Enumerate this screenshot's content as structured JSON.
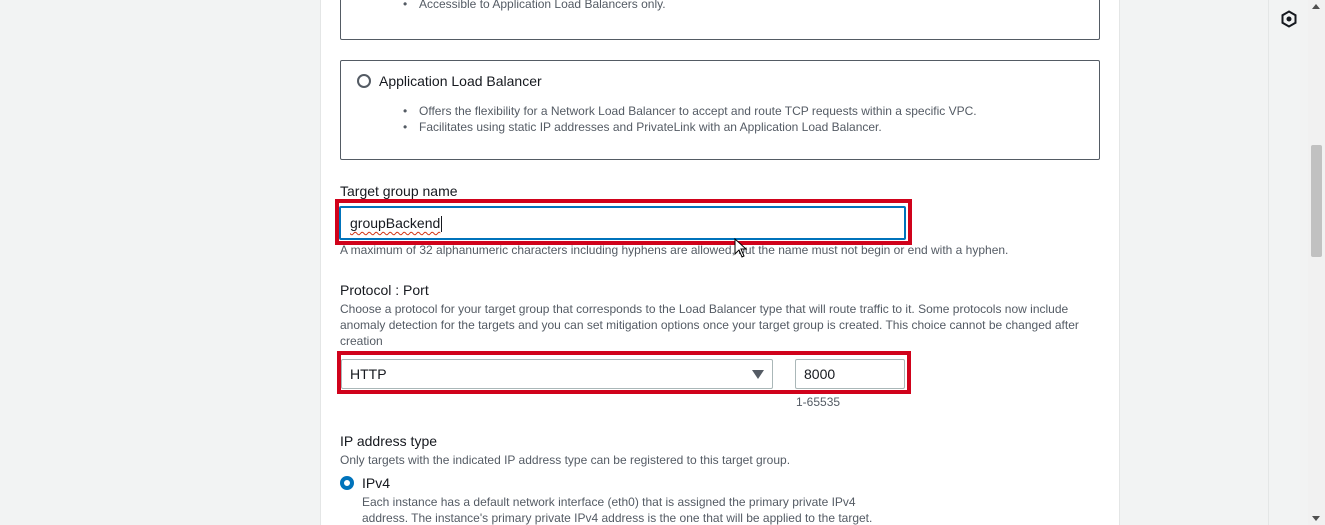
{
  "top_option": {
    "bullets": [
      "Accessible to Application Load Balancers only."
    ]
  },
  "alb_option": {
    "label": "Application Load Balancer",
    "bullets": [
      "Offers the flexibility for a Network Load Balancer to accept and route TCP requests within a specific VPC.",
      "Facilitates using static IP addresses and PrivateLink with an Application Load Balancer."
    ]
  },
  "target_group_name": {
    "label": "Target group name",
    "value": "groupBackend",
    "hint": "A maximum of 32 alphanumeric characters including hyphens are allowed, but the name must not begin or end with a hyphen."
  },
  "protocol_port": {
    "label": "Protocol : Port",
    "description": "Choose a protocol for your target group that corresponds to the Load Balancer type that will route traffic to it. Some protocols now include anomaly detection for the targets and you can set mitigation options once your target group is created. This choice cannot be changed after creation",
    "protocol_value": "HTTP",
    "port_value": "8000",
    "port_hint": "1-65535"
  },
  "ip_address_type": {
    "label": "IP address type",
    "description": "Only targets with the indicated IP address type can be registered to this target group.",
    "ipv4_label": "IPv4",
    "ipv4_description": "Each instance has a default network interface (eth0) that is assigned the primary private IPv4 address. The instance's primary private IPv4 address is the one that will be applied to the target."
  },
  "colors": {
    "highlight": "#d0021b",
    "accent": "#0073bb"
  },
  "icons": {
    "side_panel": "hexagon-settings-icon"
  }
}
